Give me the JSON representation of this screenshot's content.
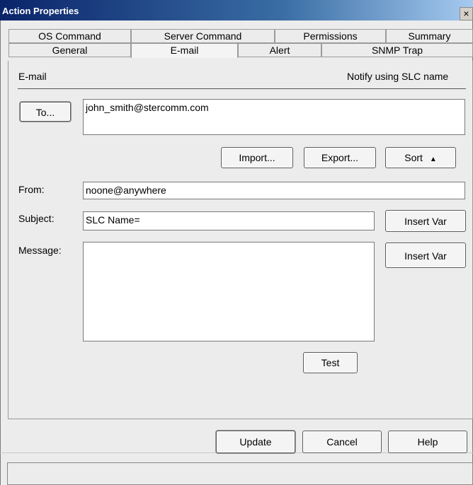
{
  "window": {
    "title": "Action Properties",
    "close_glyph": "×"
  },
  "tabs": {
    "row1": [
      "OS Command",
      "Server Command",
      "Permissions",
      "Summary"
    ],
    "row2": [
      "General",
      "E-mail",
      "Alert",
      "SNMP Trap"
    ],
    "selected": "E-mail"
  },
  "panel": {
    "section_label": "E-mail",
    "notify_label": "Notify using SLC name",
    "to_button": "To...",
    "to_value": "john_smith@stercomm.com",
    "import_button": "Import...",
    "export_button": "Export...",
    "sort_button": "Sort",
    "sort_glyph": "▲",
    "from_label": "From:",
    "from_value": "noone@anywhere",
    "subject_label": "Subject:",
    "subject_value": "SLC Name=",
    "subject_insert_button": "Insert Var",
    "message_label": "Message:",
    "message_value": "",
    "message_insert_button": "Insert Var",
    "test_button": "Test"
  },
  "footer": {
    "update_button": "Update",
    "cancel_button": "Cancel",
    "help_button": "Help"
  },
  "status": {
    "text": ""
  }
}
